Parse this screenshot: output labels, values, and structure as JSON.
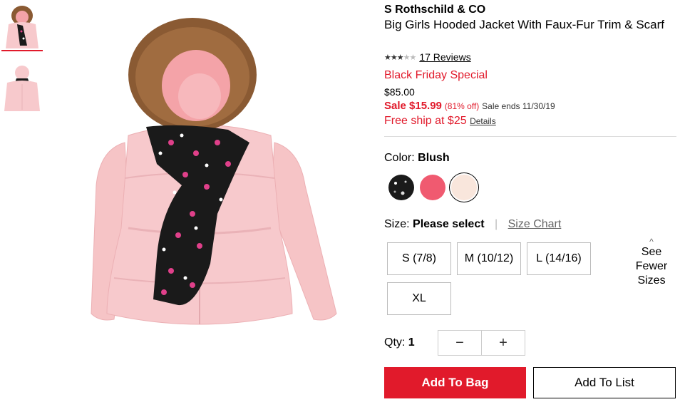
{
  "thumbnails": [
    {
      "label": "jacket-with-scarf-front",
      "active": true
    },
    {
      "label": "jacket-back-view",
      "active": false
    }
  ],
  "product": {
    "brand": "S Rothschild & CO",
    "title": "Big Girls Hooded Jacket With Faux-Fur Trim & Scarf",
    "rating_stars": 3,
    "rating_max": 5,
    "reviews_label": "17 Reviews",
    "promo": "Black Friday Special",
    "original_price": "$85.00",
    "sale_label": "Sale $15.99",
    "discount": "(81% off)",
    "sale_ends": "Sale ends 11/30/19",
    "shipping": "Free ship at $25",
    "details_link": "Details"
  },
  "color": {
    "label": "Color:",
    "selected": "Blush",
    "swatches": [
      {
        "name": "black-star-print",
        "hex": "#1a1a1a"
      },
      {
        "name": "pink",
        "hex": "#f05a70"
      },
      {
        "name": "blush",
        "hex": "#f9e6dc"
      }
    ]
  },
  "size": {
    "label": "Size:",
    "selected": "Please select",
    "chart_link": "Size Chart",
    "options": [
      "S (7/8)",
      "M (10/12)",
      "L (14/16)",
      "XL"
    ],
    "fewer_line1": "See",
    "fewer_line2": "Fewer",
    "fewer_line3": "Sizes"
  },
  "quantity": {
    "label": "Qty:",
    "value": "1",
    "minus": "−",
    "plus": "+"
  },
  "actions": {
    "add_to_bag": "Add To Bag",
    "add_to_list": "Add To List"
  },
  "colors": {
    "accent": "#e11a2b",
    "jacket": "#f7c9cc",
    "fur": "#8a5a33"
  }
}
